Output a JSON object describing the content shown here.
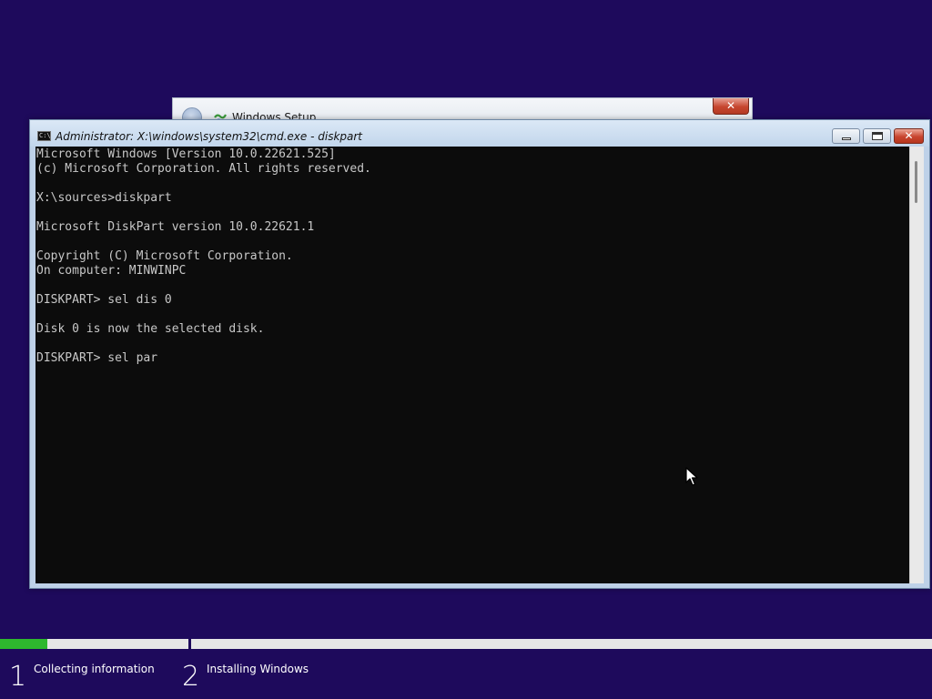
{
  "setup_window": {
    "title": "Windows Setup",
    "close_glyph": "✕"
  },
  "cmd_window": {
    "icon_text": "C:\\",
    "title": "Administrator: X:\\windows\\system32\\cmd.exe - diskpart",
    "close_glyph": "✕",
    "console_lines": [
      "Microsoft Windows [Version 10.0.22621.525]",
      "(c) Microsoft Corporation. All rights reserved.",
      "",
      "X:\\sources>diskpart",
      "",
      "Microsoft DiskPart version 10.0.22621.1",
      "",
      "Copyright (C) Microsoft Corporation.",
      "On computer: MINWINPC",
      "",
      "DISKPART> sel dis 0",
      "",
      "Disk 0 is now the selected disk.",
      "",
      "DISKPART> sel par"
    ]
  },
  "progress": {
    "step1_fill_fraction": 0.25,
    "fill_color": "#2eb82e",
    "steps": [
      {
        "number": "1",
        "label": "Collecting information"
      },
      {
        "number": "2",
        "label": "Installing Windows"
      }
    ]
  },
  "colors": {
    "desktop_background": "#1e0a5c",
    "console_background": "#0c0c0c",
    "console_text": "#c8c8c8"
  },
  "icons": {
    "back": "back-arrow-icon",
    "setup": "windows-setup-icon",
    "cmd": "command-prompt-icon",
    "cursor": "mouse-cursor-icon"
  }
}
